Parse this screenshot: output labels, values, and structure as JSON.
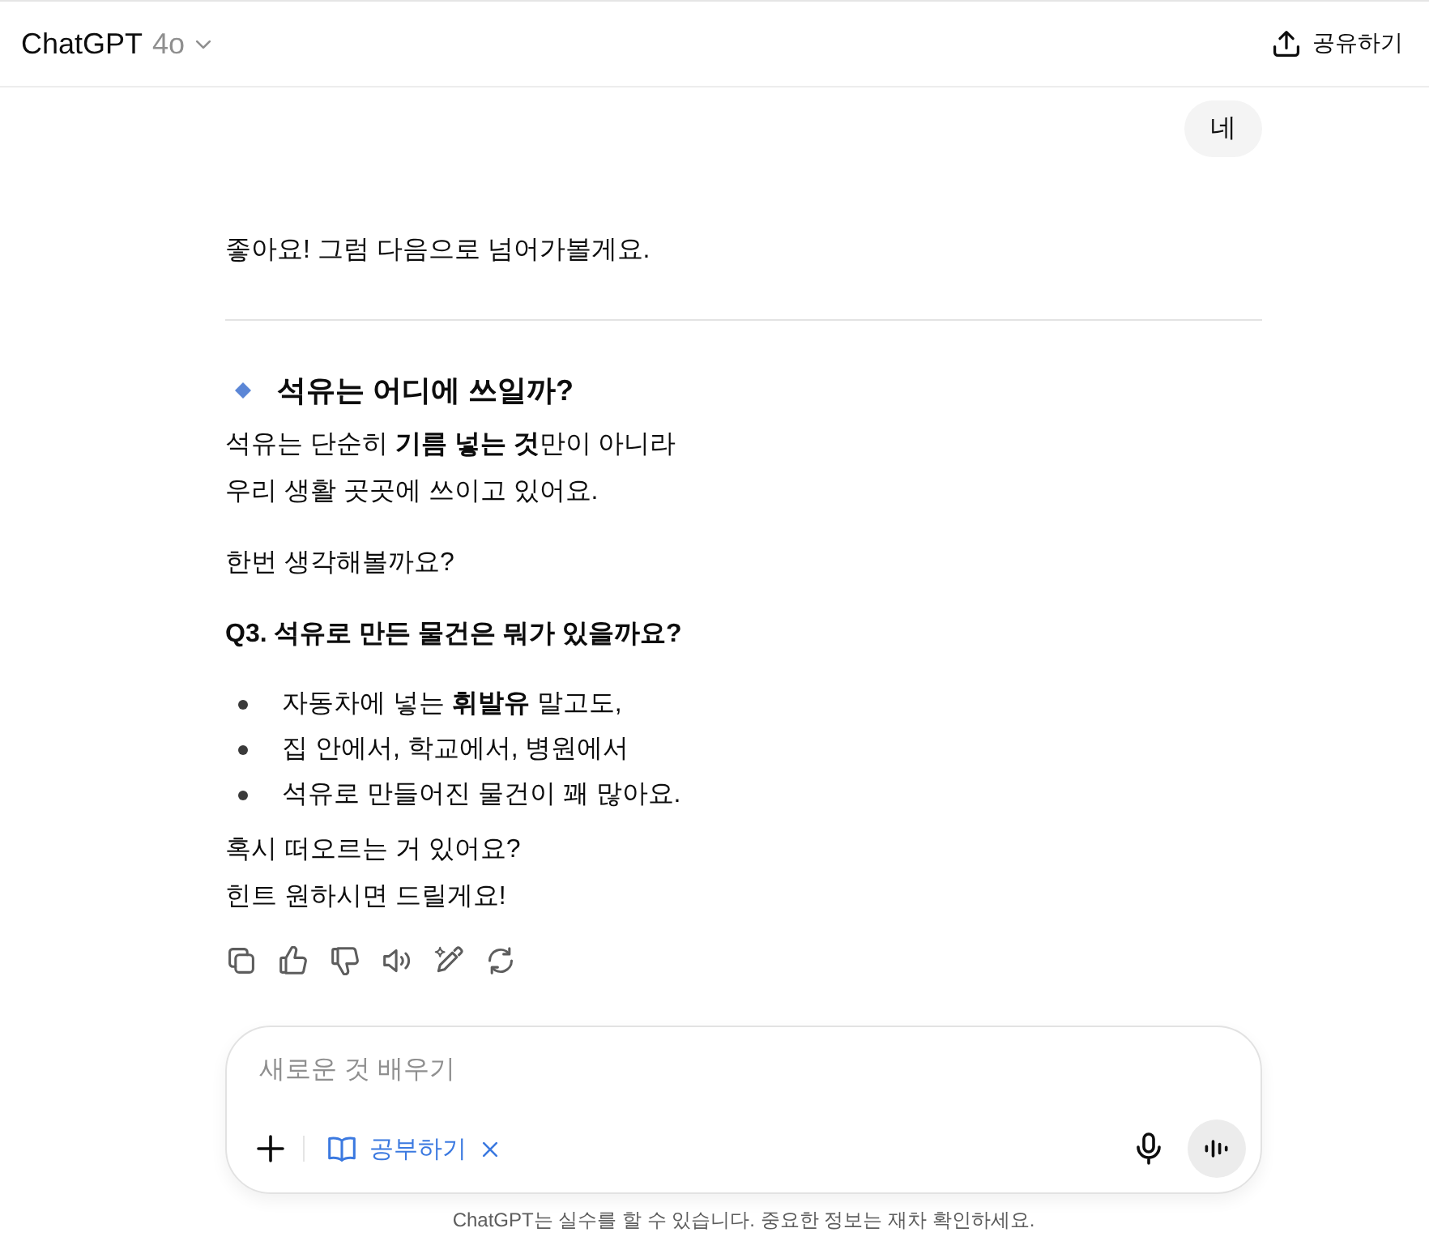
{
  "header": {
    "title": "ChatGPT",
    "model": "4o",
    "share": {
      "label": "공유하기"
    }
  },
  "conversation": [
    {
      "kind": "user",
      "text": "네"
    },
    {
      "kind": "assistant",
      "blocks": [
        {
          "kind": "paragraph",
          "lines": [
            "좋아요! 그럼 다음으로 넘어가볼게요."
          ]
        },
        {
          "kind": "divider"
        },
        {
          "kind": "heading",
          "text": "석유는 어디에 쓰일까?"
        },
        {
          "kind": "paragraph",
          "lines": [
            "석유는 단순히 **기름 넣는 것**만이 아니라",
            "우리 생활 곳곳에 쓰이고 있어요."
          ]
        },
        {
          "kind": "paragraph",
          "lines": [
            "한번 생각해볼까요?"
          ]
        },
        {
          "kind": "strong",
          "lines": [
            "Q3. 석유로 만든 물건은 뭐가 있을까요?"
          ]
        },
        {
          "kind": "list",
          "items": [
            "자동차에 넣는 **휘발유** 말고도,",
            "집 안에서, 학교에서, 병원에서",
            "석유로 만들어진 물건이 꽤 많아요."
          ]
        },
        {
          "kind": "paragraph",
          "lines": [
            "혹시 떠오르는 거 있어요?",
            "힌트 원하시면 드릴게요!"
          ]
        }
      ]
    }
  ],
  "composer": {
    "placeholder": "새로운 것 배우기",
    "tool": {
      "label": "공부하기"
    }
  },
  "footer": {
    "text": "ChatGPT는 실수를 할 수 있습니다. 중요한 정보는 재차 확인하세요."
  }
}
